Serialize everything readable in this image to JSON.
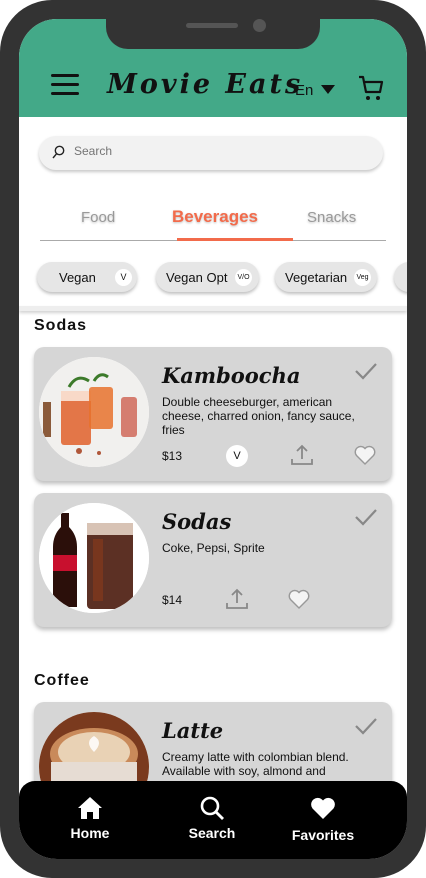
{
  "header": {
    "title": "Movie Eats",
    "language": "En"
  },
  "search": {
    "placeholder": "Search"
  },
  "tabs": [
    {
      "label": "Food"
    },
    {
      "label": "Beverages"
    },
    {
      "label": "Snacks"
    }
  ],
  "filters": [
    {
      "label": "Vegan",
      "badge": "V"
    },
    {
      "label": "Vegan Opt",
      "badge": "V/O"
    },
    {
      "label": "Vegetarian",
      "badge": "Veg"
    }
  ],
  "sections": [
    {
      "title": "Sodas",
      "items": [
        {
          "name": "Kamboocha",
          "description": "Double cheeseburger, american cheese, charred onion, fancy sauce, fries",
          "price": "$13",
          "badge": "V"
        },
        {
          "name": "Sodas",
          "description": "Coke, Pepsi, Sprite",
          "price": "$14"
        }
      ]
    },
    {
      "title": "Coffee",
      "items": [
        {
          "name": "Latte",
          "description": "Creamy latte with colombian blend. Available with soy, almond and"
        }
      ]
    }
  ],
  "bottom_nav": [
    {
      "label": "Home"
    },
    {
      "label": "Search"
    },
    {
      "label": "Favorites"
    }
  ],
  "colors": {
    "header": "#43a988",
    "accent": "#f26b4b",
    "card": "#d6d6d6",
    "nav": "#000000"
  }
}
